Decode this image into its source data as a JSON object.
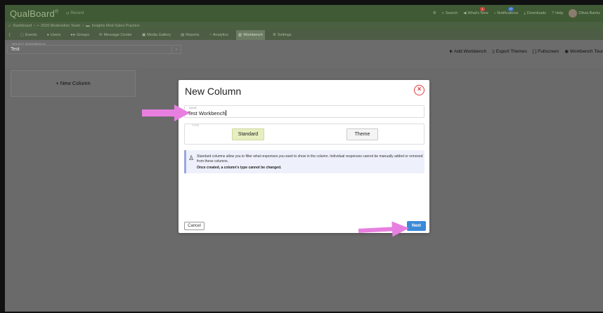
{
  "app": {
    "logo": "QualBoard",
    "logo_mark": "®",
    "recent": "Recent"
  },
  "topnav": {
    "search": "Search",
    "whats_new": "What's New",
    "whats_new_badge": "1",
    "notifications": "Notifications",
    "notifications_badge": "27",
    "downloads": "Downloads",
    "help": "Help",
    "user": "Olivia Banks"
  },
  "breadcrumbs": [
    "Dashboard",
    "2020 Moderation Team",
    "Insights Mod-Sales Practice"
  ],
  "navtabs": [
    {
      "label": "Events"
    },
    {
      "label": "Users"
    },
    {
      "label": "Groups"
    },
    {
      "label": "Message Center"
    },
    {
      "label": "Media Gallery"
    },
    {
      "label": "Reports"
    },
    {
      "label": "Analytics"
    },
    {
      "label": "Workbench"
    },
    {
      "label": "Settings"
    }
  ],
  "workbench": {
    "select_label": "SELECT WORKBENCH",
    "selected": "Test",
    "actions": {
      "add": "Add Workbench",
      "export": "Export Themes",
      "fullscreen": "Fullscreen",
      "tour": "Workbench Tour"
    },
    "new_column_card": "+ New Column"
  },
  "modal": {
    "title": "New Column",
    "name_label": "NAME",
    "name_value": "Test Workbench",
    "type_label": "TYPE",
    "type_standard": "Standard",
    "type_theme": "Theme",
    "info_text": "Standard columns allow you to filter what responses you want to show in the column. Individual responses cannot be manually added or removed from these columns.",
    "info_bold": "Once created, a column's type cannot be changed.",
    "cancel": "Cancel",
    "next": "Next"
  },
  "colors": {
    "arrow": "#e87fe0",
    "next_button": "#3b8ad8",
    "close_icon": "#e03c3c",
    "standard_selected": "#e7eebf"
  }
}
